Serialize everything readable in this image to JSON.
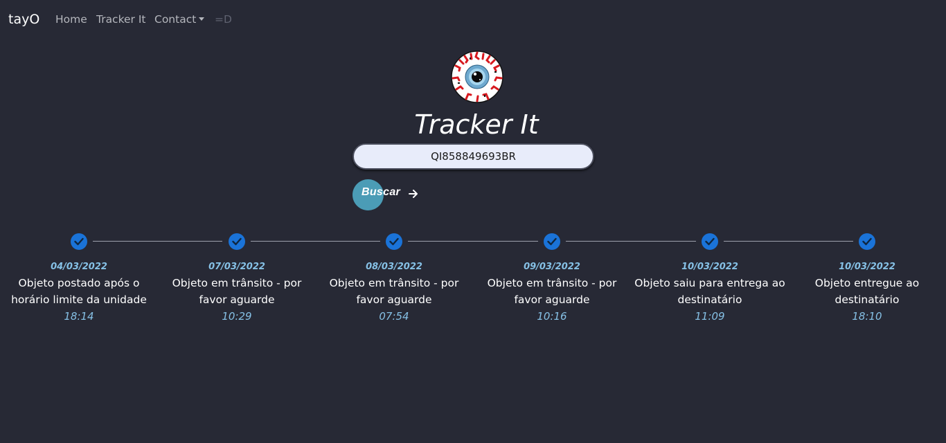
{
  "nav": {
    "brand": "tayO",
    "items": [
      {
        "label": "Home"
      },
      {
        "label": "Tracker It"
      },
      {
        "label": "Contact"
      },
      {
        "label": "=D"
      }
    ]
  },
  "main": {
    "logo_icon": "eyeball-icon",
    "title": "Tracker It",
    "search": {
      "value": "QI858849693BR",
      "placeholder": ""
    },
    "search_button": {
      "label": "Buscar",
      "icon": "arrow-right-icon"
    }
  },
  "timeline": {
    "steps": [
      {
        "date": "04/03/2022",
        "description": "Objeto postado após o horário limite da unidade",
        "time": "18:14"
      },
      {
        "date": "07/03/2022",
        "description": "Objeto em trânsito - por favor aguarde",
        "time": "10:29"
      },
      {
        "date": "08/03/2022",
        "description": "Objeto em trânsito - por favor aguarde",
        "time": "07:54"
      },
      {
        "date": "09/03/2022",
        "description": "Objeto em trânsito - por favor aguarde",
        "time": "10:16"
      },
      {
        "date": "10/03/2022",
        "description": "Objeto saiu para entrega ao destinatário",
        "time": "11:09"
      },
      {
        "date": "10/03/2022",
        "description": "Objeto entregue ao destinatário",
        "time": "18:10"
      }
    ]
  },
  "colors": {
    "background": "#272935",
    "accent": "#1a73d8",
    "date_text": "#86c1e6",
    "button": "#4b9cb6"
  }
}
